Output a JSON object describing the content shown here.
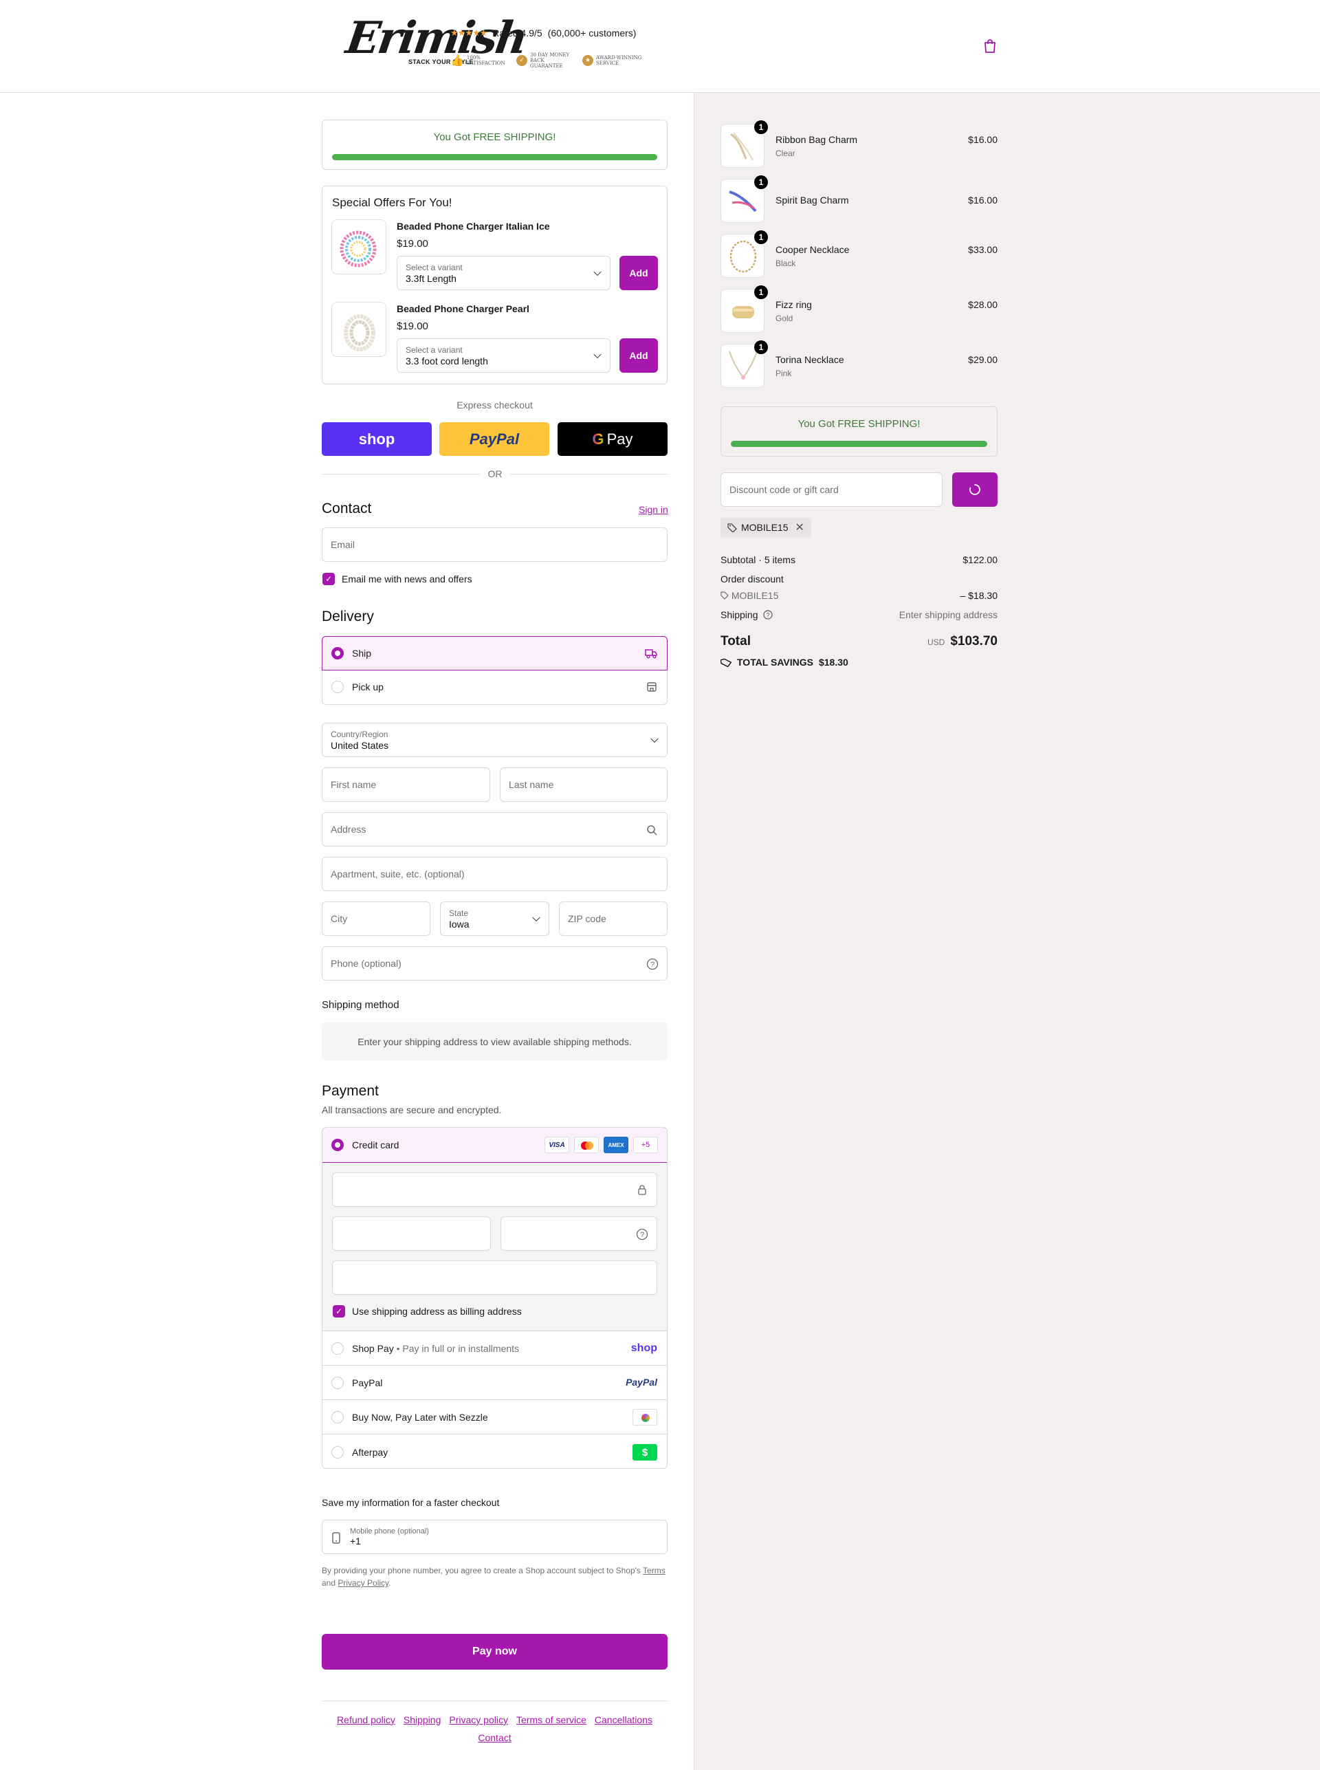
{
  "header": {
    "logo_text": "Erimish",
    "logo_tagline": "STACK YOUR STYLE",
    "stars": "★★★★★",
    "rating": "Rated 4.9/5",
    "customers": "(60,000+ customers)",
    "badges": [
      {
        "line1": "100%",
        "line2": "SATISFACTION"
      },
      {
        "line1": "30 DAY MONEY",
        "line2": "BACK GUARANTEE"
      },
      {
        "line1": "AWARD-WINNING",
        "line2": "SERVICE"
      }
    ]
  },
  "free_shipping": {
    "prefix": "You Got ",
    "highlight": "FREE SHIPPING!",
    "progress": 1.0
  },
  "offers": {
    "title": "Special Offers For You!",
    "items": [
      {
        "name": "Beaded Phone Charger Italian Ice",
        "price": "$19.00",
        "variant_label": "Select a variant",
        "variant": "3.3ft Length",
        "button": "Add"
      },
      {
        "name": "Beaded Phone Charger Pearl",
        "price": "$19.00",
        "variant_label": "Select a variant",
        "variant": "3.3 foot cord length",
        "button": "Add"
      }
    ]
  },
  "express": {
    "title": "Express checkout",
    "shop": "shop",
    "paypal": "PayPal",
    "gpay": "Pay",
    "or": "OR"
  },
  "contact": {
    "title": "Contact",
    "sign_in": "Sign in",
    "email_placeholder": "Email",
    "news_label": "Email me with news and offers"
  },
  "delivery": {
    "title": "Delivery",
    "options": [
      {
        "label": "Ship",
        "selected": true
      },
      {
        "label": "Pick up",
        "selected": false
      }
    ],
    "country_label": "Country/Region",
    "country": "United States",
    "first_name": "First name",
    "last_name": "Last name",
    "address": "Address",
    "apartment": "Apartment, suite, etc. (optional)",
    "city": "City",
    "state_label": "State",
    "state": "Iowa",
    "zip": "ZIP code",
    "phone": "Phone (optional)"
  },
  "shipping_method": {
    "title": "Shipping method",
    "message": "Enter your shipping address to view available shipping methods."
  },
  "payment": {
    "title": "Payment",
    "subtitle": "All transactions are secure and encrypted.",
    "credit_card": "Credit card",
    "cards": [
      "VISA",
      "MC",
      "AMEX",
      "+5"
    ],
    "billing_label": "Use shipping address as billing address",
    "shop_pay": "Shop Pay",
    "shop_pay_sub": "Pay in full or in installments",
    "shop_logo": "shop",
    "paypal": "PayPal",
    "paypal_logo": "PayPal",
    "sezzle": "Buy Now, Pay Later with Sezzle",
    "afterpay": "Afterpay",
    "afterpay_logo": "$"
  },
  "save_info": {
    "title": "Save my information for a faster checkout",
    "mobile_label": "Mobile phone (optional)",
    "mobile_value": "+1",
    "legal_1": "By providing your phone number, you agree to create a Shop account subject to Shop's ",
    "terms": "Terms",
    "legal_and": "and ",
    "privacy": "Privacy Policy",
    "legal_end": "."
  },
  "pay_now": "Pay now",
  "footer": {
    "links": [
      "Refund policy",
      "Shipping",
      "Privacy policy",
      "Terms of service",
      "Cancellations",
      "Contact"
    ]
  },
  "cart": {
    "items": [
      {
        "name": "Ribbon Bag Charm",
        "variant": "Clear",
        "price": "$16.00",
        "qty": "1"
      },
      {
        "name": "Spirit Bag Charm",
        "variant": "",
        "price": "$16.00",
        "qty": "1"
      },
      {
        "name": "Cooper Necklace",
        "variant": "Black",
        "price": "$33.00",
        "qty": "1"
      },
      {
        "name": "Fizz ring",
        "variant": "Gold",
        "price": "$28.00",
        "qty": "1"
      },
      {
        "name": "Torina Necklace",
        "variant": "Pink",
        "price": "$29.00",
        "qty": "1"
      }
    ],
    "discount_placeholder": "Discount code or gift card",
    "applied_code": "MOBILE15",
    "subtotal_label": "Subtotal · 5 items",
    "subtotal": "$122.00",
    "order_discount": "Order discount",
    "code": "MOBILE15",
    "discount": "– $18.30",
    "shipping_label": "Shipping",
    "shipping_value": "Enter shipping address",
    "total_label": "Total",
    "currency": "USD",
    "total": "$103.70",
    "savings_label": "TOTAL SAVINGS",
    "savings": "$18.30"
  },
  "colors": {
    "accent": "#a517ad",
    "success": "#4caf50",
    "shop_purple": "#5a31f4",
    "paypal_yellow": "#ffc439"
  }
}
